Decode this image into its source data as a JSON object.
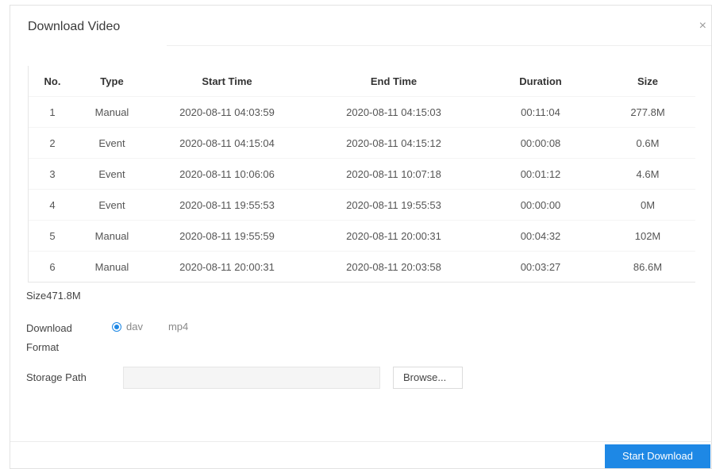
{
  "dialog": {
    "title": "Download Video",
    "close_label": "×"
  },
  "table": {
    "headers": [
      "No.",
      "Type",
      "Start Time",
      "End Time",
      "Duration",
      "Size"
    ],
    "rows": [
      [
        "1",
        "Manual",
        "2020-08-11 04:03:59",
        "2020-08-11 04:15:03",
        "00:11:04",
        "277.8M"
      ],
      [
        "2",
        "Event",
        "2020-08-11 04:15:04",
        "2020-08-11 04:15:12",
        "00:00:08",
        "0.6M"
      ],
      [
        "3",
        "Event",
        "2020-08-11 10:06:06",
        "2020-08-11 10:07:18",
        "00:01:12",
        "4.6M"
      ],
      [
        "4",
        "Event",
        "2020-08-11 19:55:53",
        "2020-08-11 19:55:53",
        "00:00:00",
        "0M"
      ],
      [
        "5",
        "Manual",
        "2020-08-11 19:55:59",
        "2020-08-11 20:00:31",
        "00:04:32",
        "102M"
      ],
      [
        "6",
        "Manual",
        "2020-08-11 20:00:31",
        "2020-08-11 20:03:58",
        "00:03:27",
        "86.6M"
      ]
    ]
  },
  "summary": {
    "size_text": "Size471.8M"
  },
  "format": {
    "label_line1": "Download",
    "label_line2": "Format",
    "options": [
      {
        "label": "dav",
        "checked": true
      },
      {
        "label": "mp4",
        "checked": false
      }
    ]
  },
  "storage": {
    "label": "Storage Path",
    "value": "",
    "browse_label": "Browse..."
  },
  "footer": {
    "start_label": "Start Download"
  },
  "colors": {
    "accent": "#1e88e5"
  }
}
